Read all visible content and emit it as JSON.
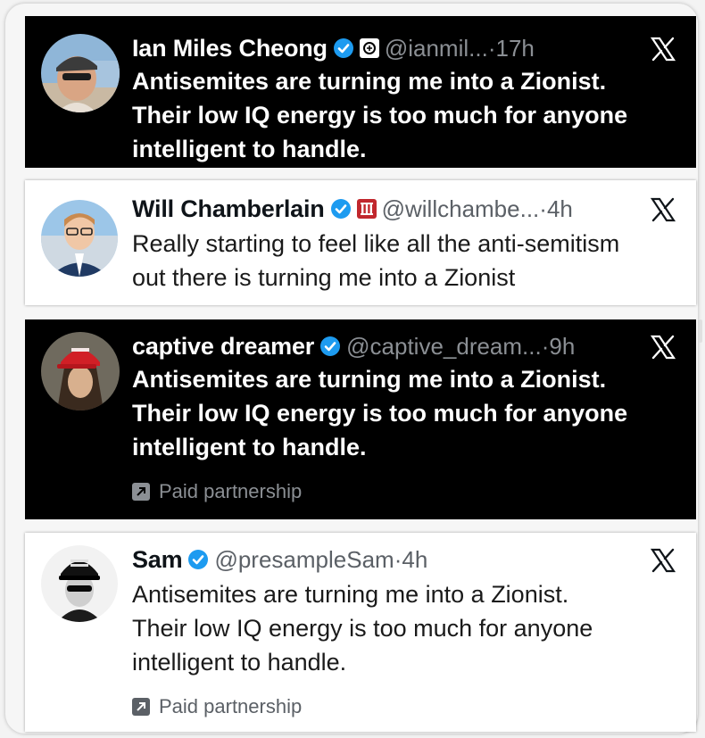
{
  "posts": [
    {
      "name": "Ian Miles Cheong",
      "handle": "@ianmil...",
      "time": "17h",
      "text_lines": [
        "Antisemites are turning me into a Zionist.",
        "Their low IQ energy is too much for anyone",
        "intelligent to handle."
      ],
      "theme": "dark",
      "badges": [
        "verified-check-icon",
        "affiliation-badge-icon"
      ]
    },
    {
      "name": "Will Chamberlain",
      "handle": "@willchambe...",
      "time": "4h",
      "text_lines": [
        "Really starting to feel like all the anti-semitism",
        "out there is turning me into a Zionist"
      ],
      "theme": "light",
      "badges": [
        "verified-check-icon",
        "affiliation-badge-icon"
      ]
    },
    {
      "name": "captive dreamer",
      "handle": "@captive_dream...",
      "time": "9h",
      "text_lines": [
        "Antisemites are turning me into a Zionist.",
        "Their low IQ energy is too much for anyone",
        "intelligent to handle."
      ],
      "footer": "Paid partnership",
      "theme": "dark",
      "badges": [
        "verified-check-icon"
      ]
    },
    {
      "name": "Sam",
      "handle": "@presampleSam",
      "time": "4h",
      "text_lines": [
        "Antisemites are turning me into a Zionist.",
        "Their low IQ energy is too much for anyone",
        "intelligent to handle."
      ],
      "footer": "Paid partnership",
      "theme": "light",
      "badges": [
        "verified-check-icon"
      ]
    }
  ],
  "separator": " · ",
  "colors": {
    "verified_blue": "#1d9bf0",
    "dark_bg": "#000000",
    "light_bg": "#ffffff",
    "muted_gray": "#8b8f94",
    "affiliation_red": "#c1272d"
  }
}
